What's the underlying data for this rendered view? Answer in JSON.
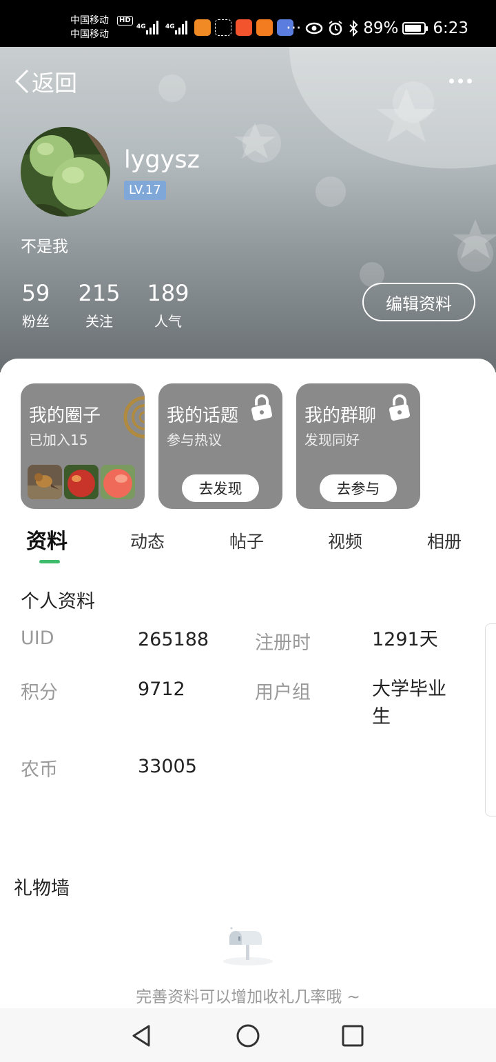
{
  "status_bar": {
    "carrier_1": "中国移动",
    "carrier_2": "中国移动",
    "hd": "HD",
    "network_1": "4G",
    "network_2": "4G",
    "battery": "89%",
    "battery_level": 0.89,
    "time": "6:23",
    "ellipsis": "···"
  },
  "header": {
    "back_label": "返回",
    "username": "lygysz",
    "level": "LV.17",
    "bio": "不是我",
    "stats": [
      {
        "value": "59",
        "label": "粉丝"
      },
      {
        "value": "215",
        "label": "关注"
      },
      {
        "value": "189",
        "label": "人气"
      }
    ],
    "edit_button": "编辑资料"
  },
  "cards": [
    {
      "title": "我的圈子",
      "subtitle": "已加入15"
    },
    {
      "title": "我的话题",
      "subtitle": "参与热议",
      "button": "去发现"
    },
    {
      "title": "我的群聊",
      "subtitle": "发现同好",
      "button": "去参与"
    }
  ],
  "tabs": [
    "资料",
    "动态",
    "帖子",
    "视频",
    "相册"
  ],
  "profile": {
    "section_title": "个人资料",
    "uid_label": "UID",
    "uid_value": "265188",
    "reg_label": "注册时",
    "reg_value": "1291天",
    "points_label": "积分",
    "points_value": "9712",
    "group_label": "用户组",
    "group_value_line1": "大学毕业",
    "group_value_line2": "生",
    "coins_label": "农币",
    "coins_value": "33005"
  },
  "gifts": {
    "title": "礼物墙",
    "hint": "完善资料可以增加收礼几率哦 ~"
  }
}
